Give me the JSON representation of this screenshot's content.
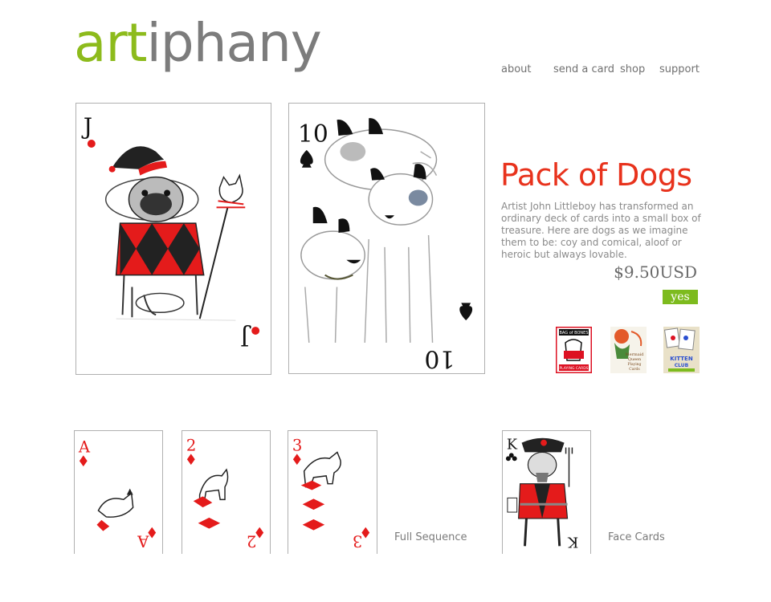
{
  "header": {
    "logo_part1": "art",
    "logo_part2": "iphany",
    "nav": [
      {
        "label": "about"
      },
      {
        "label": "send a card"
      },
      {
        "label": "shop"
      },
      {
        "label": "support"
      }
    ]
  },
  "product": {
    "title": "Pack of Dogs",
    "description": "Artist John Littleboy has transformed an ordinary deck of cards into a small box of treasure. Here are dogs as we imagine them to be: coy and comical, aloof or heroic but always lovable.",
    "price": "$9.50USD",
    "buy_label": "yes"
  },
  "cards": {
    "jack": {
      "rank": "J"
    },
    "ten": {
      "rank": "10"
    },
    "ace": {
      "rank": "A"
    },
    "two": {
      "rank": "2"
    },
    "three": {
      "rank": "3"
    },
    "king": {
      "rank": "K"
    }
  },
  "related": [
    {
      "line1": "BAG of BONES",
      "line2": "PLAYING CARDS"
    },
    {
      "line1": "Mermaid",
      "line2": "Queen",
      "line3": "Playing",
      "line4": "Cards"
    },
    {
      "line1": "KITTEN",
      "line2": "CLUB"
    }
  ],
  "captions": {
    "full_sequence": "Full Sequence",
    "face_cards": "Face Cards"
  },
  "colors": {
    "logo_green": "#8dbb1c",
    "logo_gray": "#7c7c7c",
    "title_red": "#e8321c",
    "button_green": "#7dbb1e"
  }
}
